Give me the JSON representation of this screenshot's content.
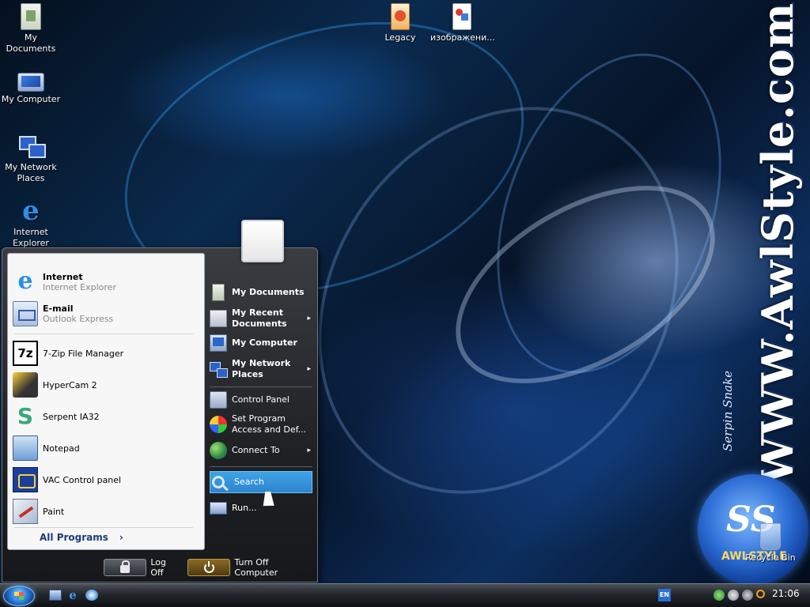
{
  "desktop": {
    "icons": [
      {
        "label": "My Documents",
        "icon": "my-documents-icon"
      },
      {
        "label": "My Computer",
        "icon": "my-computer-icon"
      },
      {
        "label": "My Network Places",
        "icon": "network-places-icon"
      },
      {
        "label": "Internet Explorer",
        "icon": "internet-explorer-icon"
      },
      {
        "label": "Legacy",
        "icon": "legacy-icon"
      },
      {
        "label": "изображени...",
        "icon": "image-file-icon"
      },
      {
        "label": "Recycle Bin",
        "icon": "recycle-bin-icon"
      }
    ]
  },
  "wallpaper": {
    "brand": "WWW.AwlStyle.com",
    "subtitle": "Serpin Snake",
    "logo_word": "AWLSTYLE"
  },
  "start_menu": {
    "pinned": [
      {
        "title": "Internet",
        "subtitle": "Internet Explorer",
        "icon": "internet-explorer-icon"
      },
      {
        "title": "E-mail",
        "subtitle": "Outlook Express",
        "icon": "email-icon"
      }
    ],
    "recent": [
      {
        "title": "7-Zip File Manager",
        "icon": "7zip-icon"
      },
      {
        "title": "HyperCam 2",
        "icon": "hypercam-icon"
      },
      {
        "title": "Serpent IA32",
        "icon": "serpent-icon"
      },
      {
        "title": "Notepad",
        "icon": "notepad-icon"
      },
      {
        "title": "VAC Control panel",
        "icon": "vac-icon"
      },
      {
        "title": "Paint",
        "icon": "paint-icon"
      }
    ],
    "all_programs": "All Programs",
    "all_programs_arrow": "›",
    "places": [
      {
        "label": "My Documents",
        "icon": "my-documents-icon"
      },
      {
        "label": "My Recent Documents",
        "icon": "recent-documents-icon",
        "arrow": "▸"
      },
      {
        "label": "My Computer",
        "icon": "my-computer-icon"
      },
      {
        "label": "My Network Places",
        "icon": "network-places-icon",
        "arrow": "▸"
      }
    ],
    "system": [
      {
        "label": "Control Panel",
        "icon": "control-panel-icon"
      },
      {
        "label": "Set Program Access and Def...",
        "icon": "set-program-access-icon"
      },
      {
        "label": "Connect To",
        "icon": "connect-to-icon",
        "arrow": "▸"
      }
    ],
    "tools": [
      {
        "label": "Search",
        "icon": "search-icon",
        "highlighted": true
      },
      {
        "label": "Run...",
        "icon": "run-icon"
      }
    ],
    "log_off": "Log Off",
    "turn_off": "Turn Off Computer"
  },
  "taskbar": {
    "language": "EN",
    "clock": "21:06"
  },
  "colors": {
    "menu_highlight": "#3ea3e6",
    "all_programs_text": "#1c3b7c"
  }
}
